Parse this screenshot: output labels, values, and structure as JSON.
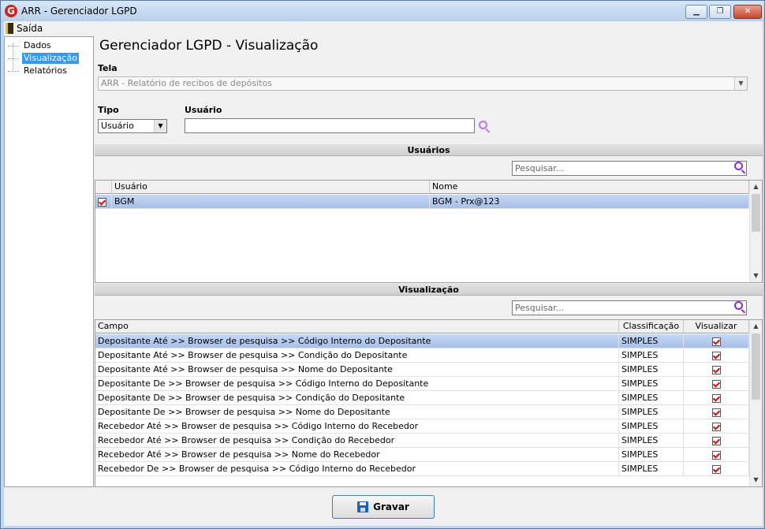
{
  "window": {
    "title": "ARR - Gerenciador LGPD",
    "icon_letter": "G"
  },
  "menu": {
    "exit_label": "Saída"
  },
  "tree": {
    "items": [
      {
        "label": "Dados",
        "selected": false
      },
      {
        "label": "Visualização",
        "selected": true
      },
      {
        "label": "Relatórios",
        "selected": false
      }
    ]
  },
  "page_title": "Gerenciador LGPD - Visualização",
  "form": {
    "tela_label": "Tela",
    "tela_value": "ARR - Relatório de recibos de depósitos",
    "tipo_label": "Tipo",
    "tipo_value": "Usuário",
    "usuario_label": "Usuário",
    "usuario_value": ""
  },
  "users_section": {
    "title": "Usuários",
    "search_placeholder": "Pesquisar...",
    "columns": [
      "Usuário",
      "Nome"
    ],
    "rows": [
      {
        "checked": true,
        "usuario": "BGM",
        "nome": "BGM - Prx@123"
      }
    ]
  },
  "view_section": {
    "title": "Visualização",
    "search_placeholder": "Pesquisar...",
    "columns": [
      "Campo",
      "Classificação",
      "Visualizar"
    ],
    "rows": [
      {
        "campo": "Depositante Até >> Browser de pesquisa >> Código Interno do Depositante",
        "classificacao": "SIMPLES",
        "visualizar": true
      },
      {
        "campo": "Depositante Até >> Browser de pesquisa >> Condição do Depositante",
        "classificacao": "SIMPLES",
        "visualizar": true
      },
      {
        "campo": "Depositante Até >> Browser de pesquisa >> Nome do Depositante",
        "classificacao": "SIMPLES",
        "visualizar": true
      },
      {
        "campo": "Depositante De >> Browser de pesquisa >> Código Interno do Depositante",
        "classificacao": "SIMPLES",
        "visualizar": true
      },
      {
        "campo": "Depositante De >> Browser de pesquisa >> Condição do Depositante",
        "classificacao": "SIMPLES",
        "visualizar": true
      },
      {
        "campo": "Depositante De >> Browser de pesquisa >> Nome do Depositante",
        "classificacao": "SIMPLES",
        "visualizar": true
      },
      {
        "campo": "Recebedor Até >> Browser de pesquisa >> Código Interno do Recebedor",
        "classificacao": "SIMPLES",
        "visualizar": true
      },
      {
        "campo": "Recebedor Até >> Browser de pesquisa >> Condição do Recebedor",
        "classificacao": "SIMPLES",
        "visualizar": true
      },
      {
        "campo": "Recebedor Até >> Browser de pesquisa >> Nome do Recebedor",
        "classificacao": "SIMPLES",
        "visualizar": true
      },
      {
        "campo": "Recebedor De >> Browser de pesquisa >> Código Interno do Recebedor",
        "classificacao": "SIMPLES",
        "visualizar": true
      }
    ]
  },
  "save_button": {
    "label": "Gravar"
  }
}
